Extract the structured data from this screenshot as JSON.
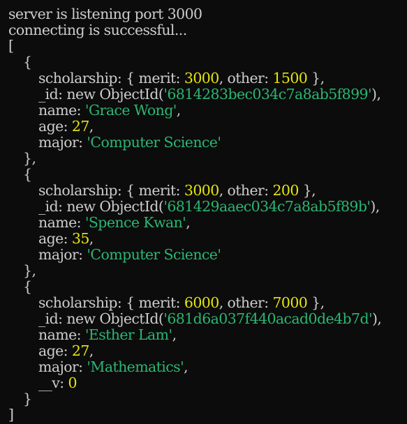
{
  "colors": {
    "background": "#0c0c0c",
    "text": "#cccccc",
    "number": "#e5e510",
    "string": "#2bb673"
  },
  "log": {
    "line1": "server is listening port 3000",
    "line2": "connecting is successful..."
  },
  "punct": {
    "open_bracket": "[",
    "close_bracket": "]",
    "open_brace": "{",
    "close_brace": "}",
    "close_brace_comma": "},"
  },
  "records": [
    {
      "scholarship_prefix": "scholarship: { merit: ",
      "merit": "3000",
      "other_prefix": ", other: ",
      "other": "1500",
      "scholarship_suffix": " },",
      "id_prefix": "_id: new ObjectId(",
      "id": "'6814283bec034c7a8ab5f899'",
      "id_suffix": "),",
      "name_key": "name: ",
      "name": "'Grace Wong'",
      "name_suffix": ",",
      "age_key": "age: ",
      "age": "27",
      "age_suffix": ",",
      "major_key": "major: ",
      "major": "'Computer Science'",
      "major_suffix": ""
    },
    {
      "scholarship_prefix": "scholarship: { merit: ",
      "merit": "3000",
      "other_prefix": ", other: ",
      "other": "200",
      "scholarship_suffix": " },",
      "id_prefix": "_id: new ObjectId(",
      "id": "'681429aaec034c7a8ab5f89b'",
      "id_suffix": "),",
      "name_key": "name: ",
      "name": "'Spence Kwan'",
      "name_suffix": ",",
      "age_key": "age: ",
      "age": "35",
      "age_suffix": ",",
      "major_key": "major: ",
      "major": "'Computer Science'",
      "major_suffix": ""
    },
    {
      "scholarship_prefix": "scholarship: { merit: ",
      "merit": "6000",
      "other_prefix": ", other: ",
      "other": "7000",
      "scholarship_suffix": " },",
      "id_prefix": "_id: new ObjectId(",
      "id": "'681d6a037f440acad0de4b7d'",
      "id_suffix": "),",
      "name_key": "name: ",
      "name": "'Esther Lam'",
      "name_suffix": ",",
      "age_key": "age: ",
      "age": "27",
      "age_suffix": ",",
      "major_key": "major: ",
      "major": "'Mathematics'",
      "major_suffix": ",",
      "v_key": "__v: ",
      "v": "0"
    }
  ]
}
